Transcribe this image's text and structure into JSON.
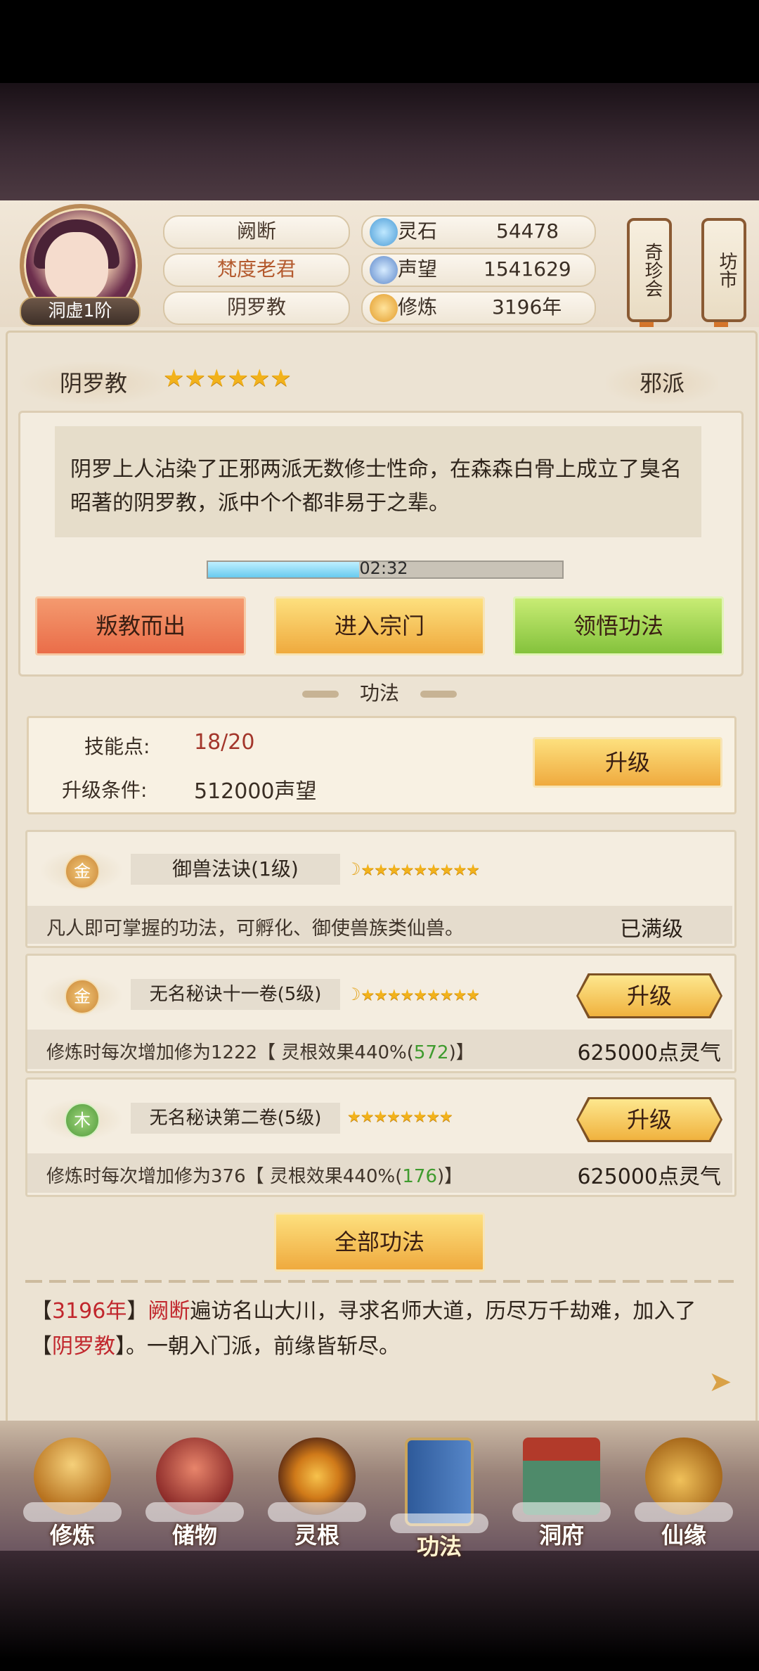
{
  "header": {
    "rank": "洞虚1阶",
    "name": "阙断",
    "title": "梵度老君",
    "sect": "阴罗教",
    "resources": [
      {
        "icon": "spirit-stone-icon",
        "label": "灵石",
        "value": "54478"
      },
      {
        "icon": "prestige-icon",
        "label": "声望",
        "value": "1541629"
      },
      {
        "icon": "cultivation-icon",
        "label": "修炼",
        "value": "3196年"
      }
    ],
    "side_buttons": [
      "奇珍会",
      "坊市"
    ]
  },
  "sect_panel": {
    "name": "阴罗教",
    "stars": 6,
    "alignment": "邪派",
    "description": "阴罗上人沾染了正邪两派无数修士性命，在森森白骨上成立了臭名昭著的阴罗教，派中个个都非易于之辈。",
    "timer": "02:32",
    "buttons": [
      "叛教而出",
      "进入宗门",
      "领悟功法"
    ]
  },
  "skills_section": {
    "title": "功法",
    "points_label": "技能点:",
    "points_value": "18/20",
    "condition_label": "升级条件:",
    "condition_value": "512000声望",
    "upgrade_label": "升级",
    "items": [
      {
        "element": "金",
        "name": "御兽法诀(1级)",
        "desc": "凡人即可掌握的功法，可孵化、御使兽族类仙兽。",
        "status": "已满级"
      },
      {
        "element": "金",
        "name": "无名秘诀十一卷(5级)",
        "desc_prefix": "修炼时每次增加修为1222【 灵根效果440%(",
        "desc_value": "572",
        "desc_suffix": ")】",
        "cost": "625000点灵气",
        "button": "升级"
      },
      {
        "element": "木",
        "name": "无名秘诀第二卷(5级)",
        "desc_prefix": "修炼时每次增加修为376【 灵根效果440%(",
        "desc_value": "176",
        "desc_suffix": ")】",
        "cost": "625000点灵气",
        "button": "升级"
      }
    ],
    "all_skills_label": "全部功法"
  },
  "log": {
    "year": "3196年",
    "name": "阙断",
    "text1": "遍访名山大川，寻求名师大道，历尽万千劫难，加入了",
    "sect": "阴罗教",
    "text2": "。一朝入门派，前缘皆斩尽。"
  },
  "nav": [
    {
      "icon": "cultivator-icon",
      "label": "修炼"
    },
    {
      "icon": "bag-icon",
      "label": "储物"
    },
    {
      "icon": "spirit-root-icon",
      "label": "灵根"
    },
    {
      "icon": "book-icon",
      "label": "功法"
    },
    {
      "icon": "cave-icon",
      "label": "洞府"
    },
    {
      "icon": "gourd-icon",
      "label": "仙缘"
    }
  ],
  "colors": {
    "accent_red": "#c1272d",
    "accent_green": "#3f9b2e",
    "star_gold": "#f2b21b"
  }
}
